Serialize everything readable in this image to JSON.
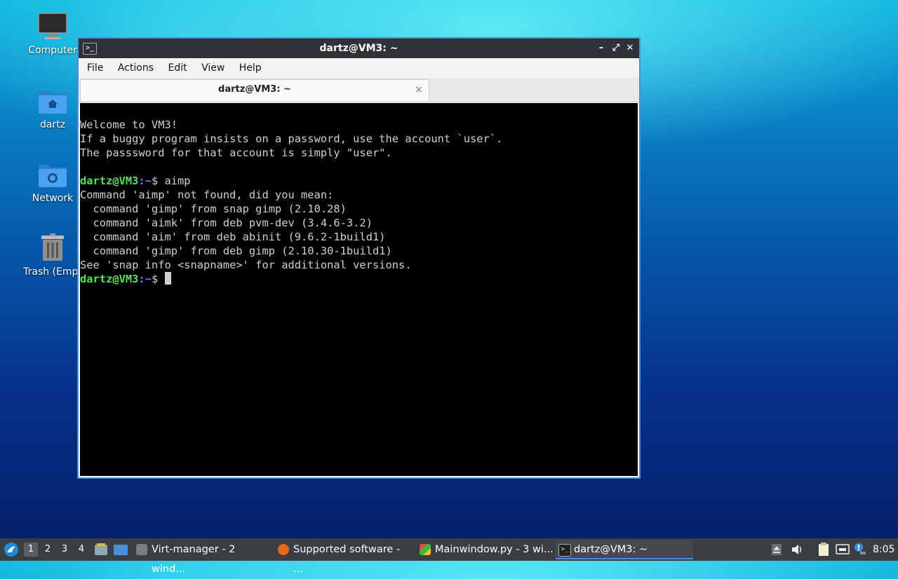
{
  "desktop": {
    "icons": [
      {
        "label": "Computer",
        "icon": "computer-icon"
      },
      {
        "label": "dartz",
        "icon": "home-folder-icon"
      },
      {
        "label": "Network",
        "icon": "network-folder-icon"
      },
      {
        "label": "Trash (Empt",
        "icon": "trash-icon"
      }
    ]
  },
  "window": {
    "title": "dartz@VM3: ~",
    "controls": {
      "minimize": "–",
      "maximize": "⤢",
      "close": "✕"
    },
    "menu": [
      "File",
      "Actions",
      "Edit",
      "View",
      "Help"
    ],
    "tab": {
      "label": "dartz@VM3: ~",
      "close": "×"
    }
  },
  "terminal": {
    "prompt_user": "dartz@VM3",
    "prompt_path": ":~",
    "prompt_symbol": "$ ",
    "command": "aimp",
    "welcome": [
      "Welcome to VM3!",
      "If a buggy program insists on a password, use the account `user`.",
      "The passsword for that account is simply \"user\"."
    ],
    "output": [
      "Command 'aimp' not found, did you mean:",
      "  command 'gimp' from snap gimp (2.10.28)",
      "  command 'aimk' from deb pvm-dev (3.4.6-3.2)",
      "  command 'aim' from deb abinit (9.6.2-1build1)",
      "  command 'gimp' from deb gimp (2.10.30-1build1)",
      "See 'snap info <snapname>' for additional versions."
    ]
  },
  "taskbar": {
    "workspaces": [
      "1",
      "2",
      "3",
      "4"
    ],
    "active_workspace": "1",
    "tasks": [
      {
        "label": "Virt-manager - 2 wind...",
        "icon": "virt-manager-icon"
      },
      {
        "label": "Supported software - ...",
        "icon": "firefox-icon"
      },
      {
        "label": "Mainwindow.py - 3 wi...",
        "icon": "python-editor-icon"
      },
      {
        "label": "dartz@VM3: ~",
        "icon": "terminal-icon"
      }
    ],
    "clock": "8:05"
  }
}
